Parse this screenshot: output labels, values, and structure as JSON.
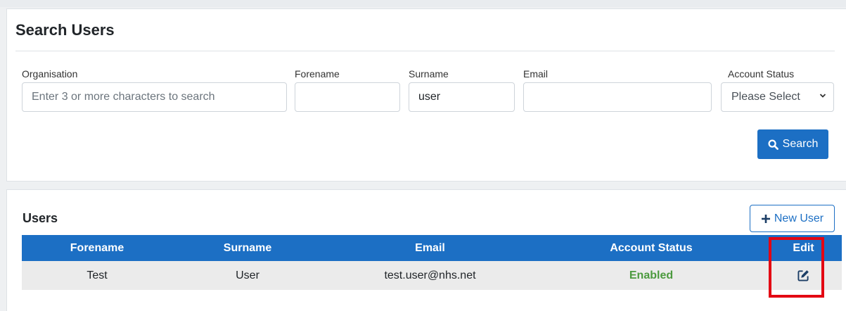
{
  "search_panel": {
    "title": "Search Users",
    "fields": {
      "organisation": {
        "label": "Organisation",
        "value": "",
        "placeholder": "Enter 3 or more characters to search"
      },
      "forename": {
        "label": "Forename",
        "value": "",
        "placeholder": ""
      },
      "surname": {
        "label": "Surname",
        "value": "user",
        "placeholder": ""
      },
      "email": {
        "label": "Email",
        "value": "",
        "placeholder": ""
      },
      "account_status": {
        "label": "Account Status",
        "selected": "Please Select"
      }
    },
    "search_button": {
      "label": "Search",
      "icon": "search-icon"
    }
  },
  "users_panel": {
    "title": "Users",
    "new_user_button": {
      "label": "New User",
      "icon": "plus-icon"
    },
    "table": {
      "columns": [
        "Forename",
        "Surname",
        "Email",
        "Account Status",
        "Edit"
      ],
      "rows": [
        {
          "forename": "Test",
          "surname": "User",
          "email": "test.user@nhs.net",
          "account_status": "Enabled",
          "edit_icon": "edit-icon"
        }
      ]
    }
  },
  "colors": {
    "primary": "#1c6fc4",
    "status_enabled": "#4c9a3f",
    "highlight": "#e30613",
    "row_background": "#ebebeb"
  }
}
